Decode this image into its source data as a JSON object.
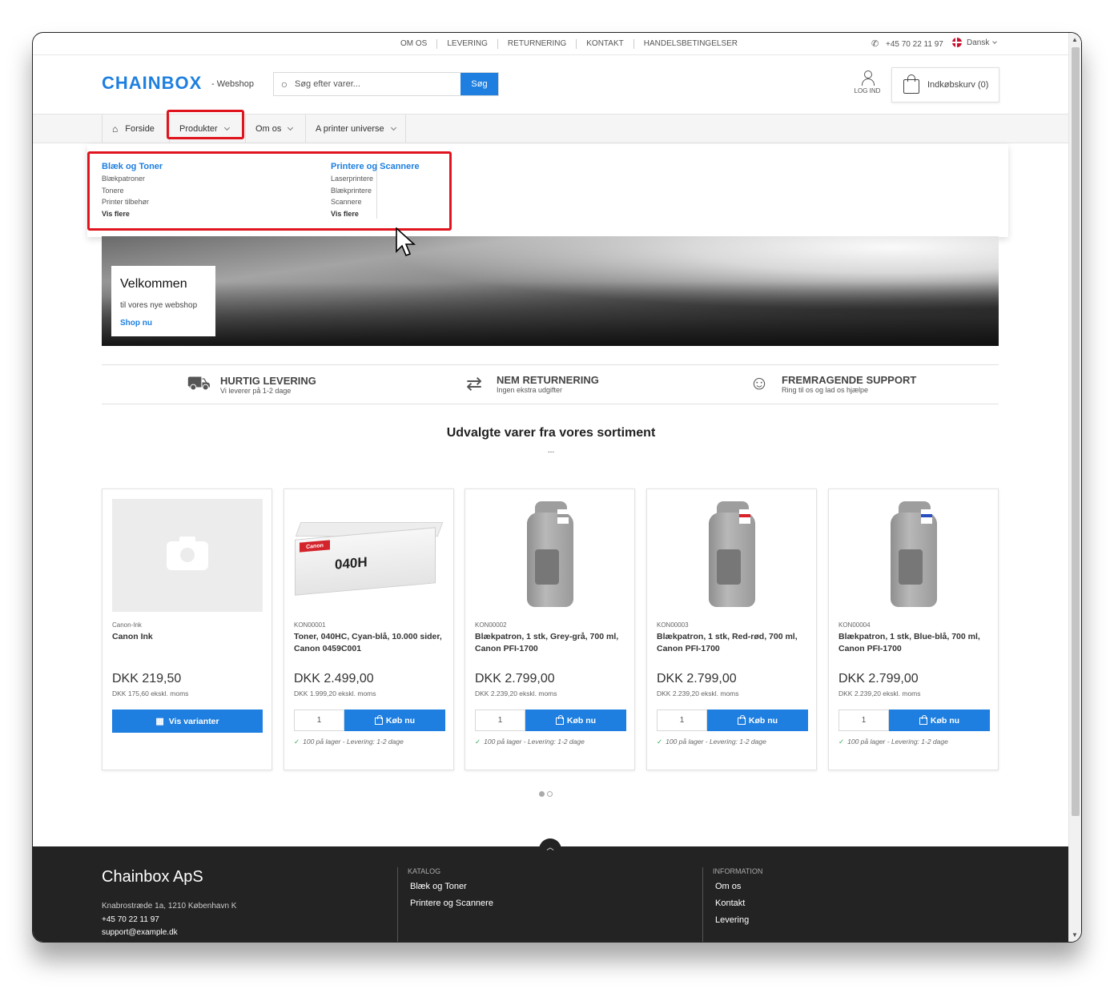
{
  "topbar": {
    "links": [
      "OM OS",
      "LEVERING",
      "RETURNERING",
      "KONTAKT",
      "HANDELSBETINGELSER"
    ],
    "phone": "+45 70 22 11 97",
    "language": "Dansk"
  },
  "header": {
    "logo": "CHAINBOX",
    "logo_sub": "- Webshop",
    "search_placeholder": "Søg efter varer...",
    "search_button": "Søg",
    "login_label": "LOG IND",
    "cart_label": "Indkøbskurv (0)"
  },
  "nav": {
    "items": [
      {
        "label": "Forside"
      },
      {
        "label": "Produkter"
      },
      {
        "label": "Om os"
      },
      {
        "label": "A printer universe"
      }
    ]
  },
  "dropdown": {
    "columns": [
      {
        "title": "Blæk og Toner",
        "links": [
          "Blækpatroner",
          "Tonere",
          "Printer tilbehør"
        ],
        "more": "Vis flere"
      },
      {
        "title": "Printere og Scannere",
        "links": [
          "Laserprintere",
          "Blækprintere",
          "Scannere"
        ],
        "more": "Vis flere"
      }
    ]
  },
  "hero": {
    "title": "Velkommen",
    "subtitle": "til vores nye webshop",
    "cta": "Shop nu"
  },
  "usps": [
    {
      "icon": "delivery-truck-icon",
      "title": "HURTIG LEVERING",
      "subtitle": "Vi leverer på 1-2 dage"
    },
    {
      "icon": "return-arrows-icon",
      "title": "NEM RETURNERING",
      "subtitle": "Ingen ekstra udgifter"
    },
    {
      "icon": "support-agent-icon",
      "title": "FREMRAGENDE SUPPORT",
      "subtitle": "Ring til os og lad os hjælpe"
    }
  ],
  "featured": {
    "title": "Udvalgte varer fra vores sortiment",
    "subtitle": "..."
  },
  "products": [
    {
      "code": "Canon-Ink",
      "name": "Canon Ink",
      "price": "DKK 219,50",
      "ex_vat": "DKK 175,60 ekskl. moms",
      "button": "Vis varianter",
      "image": "placeholder"
    },
    {
      "code": "KON00001",
      "name": "Toner, 040HC, Cyan-blå, 10.000 sider, Canon 0459C001",
      "price": "DKK 2.499,00",
      "ex_vat": "DKK 1.999,20 ekskl. moms",
      "qty": "1",
      "button": "Køb nu",
      "stock": "100 på lager - Levering: 1-2 dage",
      "image": "toner",
      "box_brand": "Canon",
      "box_code": "040H"
    },
    {
      "code": "KON00002",
      "name": "Blækpatron, 1 stk, Grey-grå, 700 ml, Canon PFI-1700",
      "price": "DKK 2.799,00",
      "ex_vat": "DKK 2.239,20 ekskl. moms",
      "qty": "1",
      "button": "Køb nu",
      "stock": "100 på lager - Levering: 1-2 dage",
      "image": "cartridge",
      "accent": "#9a9a9a"
    },
    {
      "code": "KON00003",
      "name": "Blækpatron, 1 stk, Red-rød, 700 ml, Canon PFI-1700",
      "price": "DKK 2.799,00",
      "ex_vat": "DKK 2.239,20 ekskl. moms",
      "qty": "1",
      "button": "Køb nu",
      "stock": "100 på lager - Levering: 1-2 dage",
      "image": "cartridge",
      "accent": "#d8232a"
    },
    {
      "code": "KON00004",
      "name": "Blækpatron, 1 stk, Blue-blå, 700 ml, Canon PFI-1700",
      "price": "DKK 2.799,00",
      "ex_vat": "DKK 2.239,20 ekskl. moms",
      "qty": "1",
      "button": "Køb nu",
      "stock": "100 på lager - Levering: 1-2 dage",
      "image": "cartridge",
      "accent": "#2a4fbf"
    }
  ],
  "footer": {
    "company": "Chainbox ApS",
    "address": "Knabrostræde 1a, 1210 København K",
    "phone": "+45 70 22 11 97",
    "email": "support@example.dk",
    "catalog_title": "KATALOG",
    "catalog_links": [
      "Blæk og Toner",
      "Printere og Scannere"
    ],
    "info_title": "INFORMATION",
    "info_links": [
      "Om os",
      "Kontakt",
      "Levering"
    ]
  },
  "colors": {
    "brand": "#1e7fe0",
    "highlight": "#e0141e",
    "stock_check": "#2fae52",
    "footer_bg": "#232323"
  }
}
